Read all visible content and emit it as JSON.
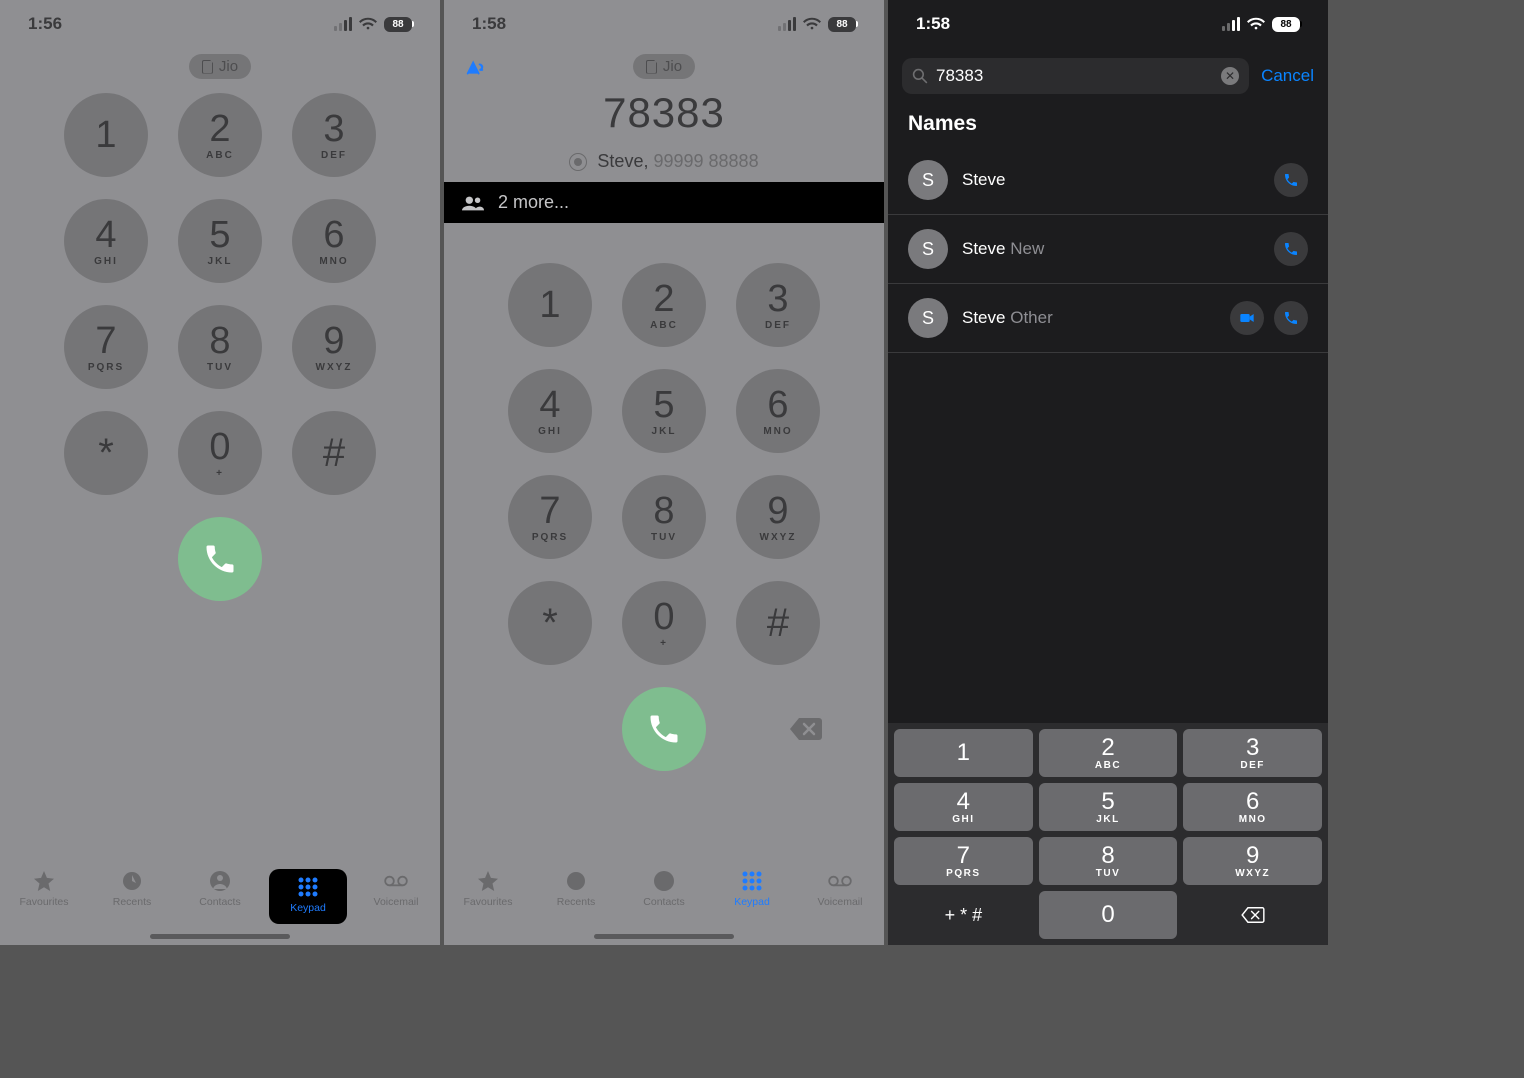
{
  "screen1": {
    "time": "1:56",
    "battery": "88",
    "carrier": "Jio",
    "keys": [
      {
        "num": "1",
        "sub": ""
      },
      {
        "num": "2",
        "sub": "ABC"
      },
      {
        "num": "3",
        "sub": "DEF"
      },
      {
        "num": "4",
        "sub": "GHI"
      },
      {
        "num": "5",
        "sub": "JKL"
      },
      {
        "num": "6",
        "sub": "MNO"
      },
      {
        "num": "7",
        "sub": "PQRS"
      },
      {
        "num": "8",
        "sub": "TUV"
      },
      {
        "num": "9",
        "sub": "WXYZ"
      },
      {
        "num": "*",
        "sub": ""
      },
      {
        "num": "0",
        "sub": "+"
      },
      {
        "num": "#",
        "sub": ""
      }
    ],
    "tabs": {
      "favourites": "Favourites",
      "recents": "Recents",
      "contacts": "Contacts",
      "keypad": "Keypad",
      "voicemail": "Voicemail"
    }
  },
  "screen2": {
    "time": "1:58",
    "battery": "88",
    "carrier": "Jio",
    "typed_number": "78383",
    "suggestion_name": "Steve,",
    "suggestion_number": "99999 88888",
    "more_text": "2 more...",
    "keys": [
      {
        "num": "1",
        "sub": ""
      },
      {
        "num": "2",
        "sub": "ABC"
      },
      {
        "num": "3",
        "sub": "DEF"
      },
      {
        "num": "4",
        "sub": "GHI"
      },
      {
        "num": "5",
        "sub": "JKL"
      },
      {
        "num": "6",
        "sub": "MNO"
      },
      {
        "num": "7",
        "sub": "PQRS"
      },
      {
        "num": "8",
        "sub": "TUV"
      },
      {
        "num": "9",
        "sub": "WXYZ"
      },
      {
        "num": "*",
        "sub": ""
      },
      {
        "num": "0",
        "sub": "+"
      },
      {
        "num": "#",
        "sub": ""
      }
    ],
    "tabs": {
      "favourites": "Favourites",
      "recents": "Recents",
      "contacts": "Contacts",
      "keypad": "Keypad",
      "voicemail": "Voicemail"
    }
  },
  "screen3": {
    "time": "1:58",
    "battery": "88",
    "search_value": "78383",
    "cancel": "Cancel",
    "section": "Names",
    "results": [
      {
        "initial": "S",
        "name": "Steve",
        "name_faded": "",
        "video": false
      },
      {
        "initial": "S",
        "name": "Steve",
        "name_faded": "New",
        "video": false
      },
      {
        "initial": "S",
        "name": "Steve",
        "name_faded": "Other",
        "video": true
      }
    ],
    "kbd": [
      {
        "num": "1",
        "sub": ""
      },
      {
        "num": "2",
        "sub": "ABC"
      },
      {
        "num": "3",
        "sub": "DEF"
      },
      {
        "num": "4",
        "sub": "GHI"
      },
      {
        "num": "5",
        "sub": "JKL"
      },
      {
        "num": "6",
        "sub": "MNO"
      },
      {
        "num": "7",
        "sub": "PQRS"
      },
      {
        "num": "8",
        "sub": "TUV"
      },
      {
        "num": "9",
        "sub": "WXYZ"
      }
    ],
    "kbd_symbols": "+ * #",
    "kbd_zero": "0"
  }
}
